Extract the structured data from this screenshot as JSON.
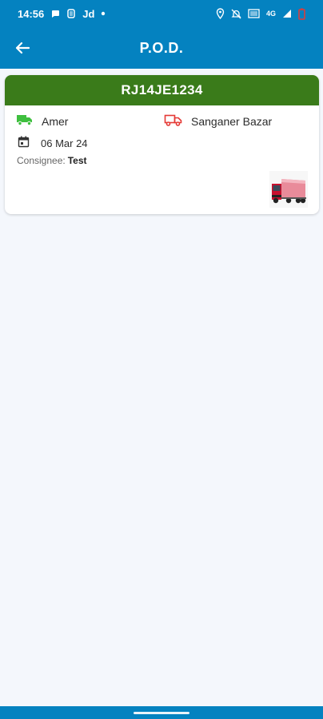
{
  "status_bar": {
    "time": "14:56",
    "carrier_label": "Jd",
    "network": "4G",
    "colors": {
      "battery": "#e53935"
    }
  },
  "app_bar": {
    "title": "P.O.D.",
    "back_icon": "arrow-left-icon"
  },
  "card": {
    "vehicle_number": "RJ14JE1234",
    "origin": "Amer",
    "destination": "Sanganer Bazar",
    "date": "06 Mar 24",
    "consignee_label": "Consignee:",
    "consignee_value": "Test",
    "icons": {
      "origin": "green-truck-icon",
      "destination": "red-truck-icon",
      "date": "calendar-icon",
      "thumbnail": "truck-photo-icon"
    }
  },
  "colors": {
    "brand_blue": "#0482c0",
    "header_green": "#3a7b1a",
    "origin_green": "#3fbf3f",
    "destination_red": "#e53935",
    "background": "#f4f7fc"
  }
}
